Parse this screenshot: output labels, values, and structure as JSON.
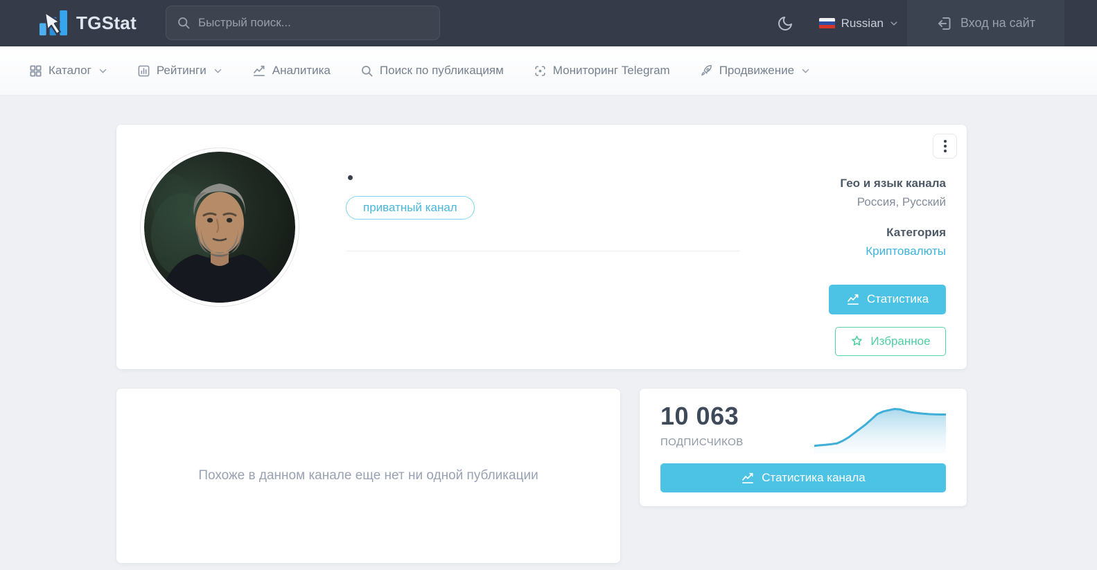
{
  "navbar": {
    "brand": "TGStat",
    "search_placeholder": "Быстрый поиск...",
    "language": "Russian",
    "login_label": "Вход на сайт"
  },
  "nav": {
    "items": [
      {
        "label": "Каталог",
        "icon": "grid-icon",
        "has_chevron": true
      },
      {
        "label": "Рейтинги",
        "icon": "bar-chart-icon",
        "has_chevron": true
      },
      {
        "label": "Аналитика",
        "icon": "line-chart-icon",
        "has_chevron": false
      },
      {
        "label": "Поиск по публикациям",
        "icon": "search-icon",
        "has_chevron": false
      },
      {
        "label": "Мониторинг Telegram",
        "icon": "scan-icon",
        "has_chevron": false
      },
      {
        "label": "Продвижение",
        "icon": "rocket-icon",
        "has_chevron": true
      }
    ]
  },
  "channel": {
    "badge": "приватный канал",
    "geo_label": "Гео и язык канала",
    "geo_value": "Россия, Русский",
    "category_label": "Категория",
    "category_value": "Криптовалюты",
    "stats_button": "Статистика",
    "favorites_button": "Избранное"
  },
  "posts_card": {
    "empty_message": "Похоже в данном канале еще нет ни одной публикации"
  },
  "subscribers_card": {
    "count": "10 063",
    "label": "подписчиков",
    "button": "Статистика канала"
  },
  "chart_data": {
    "type": "area",
    "title": "",
    "xlabel": "",
    "ylabel": "",
    "legend": false,
    "axes_hidden": true,
    "latest_value": 10063,
    "series": [
      {
        "name": "подписчиков",
        "values_normalized": [
          0.1,
          0.115,
          0.125,
          0.14,
          0.16,
          0.22,
          0.3,
          0.4,
          0.5,
          0.6,
          0.72,
          0.84,
          0.9,
          0.93,
          0.96,
          0.95,
          0.91,
          0.88,
          0.865,
          0.85,
          0.84,
          0.835,
          0.83,
          0.83
        ]
      }
    ]
  },
  "colors": {
    "navbar_bg": "#353b48",
    "accent_blue": "#4cc3e5",
    "link_blue": "#3eb3dc",
    "badge_border": "#7fd7f0",
    "favorite_green": "#4fcfa1",
    "spark_line": "#3fafd7",
    "logo_blue": "#3aa5ee"
  }
}
